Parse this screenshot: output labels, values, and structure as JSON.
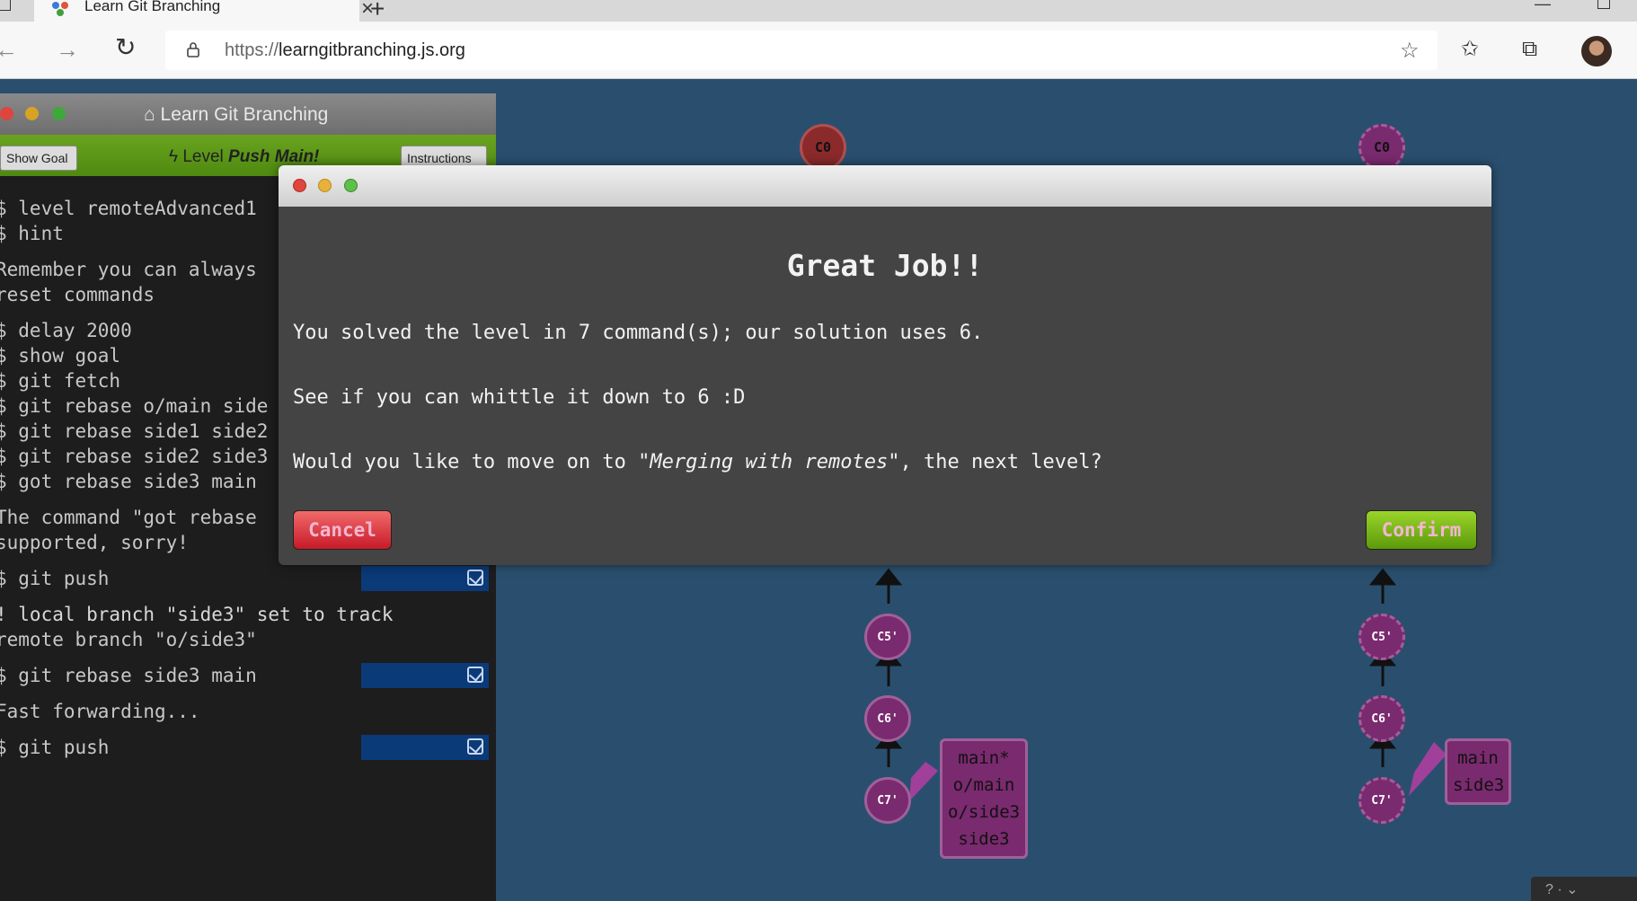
{
  "browser": {
    "tab_title": "Learn Git Branching",
    "url_prefix": "https://",
    "url_host": "learngitbranching.js.org"
  },
  "terminal": {
    "title": "Learn Git Branching",
    "show_goal_label": "Show Goal",
    "level_prefix": "Level",
    "level_name": "Push Main!",
    "instructions_label": "Instructions",
    "lines": [
      "$ level remoteAdvanced1",
      "$ hint",
      "Remember you can always",
      "reset commands",
      "$ delay 2000",
      "$ show goal",
      "$ git fetch",
      "$ git rebase o/main side",
      "$ git rebase side1 side2",
      "$ git rebase side2 side3",
      "$ got rebase side3 main",
      "The command \"got rebase",
      "supported, sorry!",
      "$ git push",
      "! local branch \"side3\" set to track",
      "remote branch \"o/side3\"",
      "$ git rebase side3 main",
      "Fast forwarding...",
      "$ git push"
    ]
  },
  "tree_left": {
    "nodes": [
      "C0",
      "C5'",
      "C6'",
      "C7'"
    ],
    "branch_labels": [
      "main*",
      "o/main",
      "o/side3",
      "side3"
    ]
  },
  "tree_right": {
    "nodes": [
      "C0",
      "C5'",
      "C6'",
      "C7'"
    ],
    "branch_labels": [
      "main",
      "side3"
    ]
  },
  "modal": {
    "heading": "Great Job!!",
    "line1": "You solved the level in 7 command(s); our solution uses 6.",
    "line2": "See if you can whittle it down to 6 :D",
    "line3_prefix": "Would you like to move on to ",
    "line3_level": "\"Merging with remotes\"",
    "line3_suffix": ", the next level?",
    "cancel_label": "Cancel",
    "confirm_label": "Confirm"
  },
  "colors": {
    "canvas_bg": "#2a4f6e",
    "commit_purple": "#7a2a6e",
    "commit_red": "#8a2a2a",
    "confirm_green": "#6fb317",
    "cancel_red": "#dc3240"
  }
}
